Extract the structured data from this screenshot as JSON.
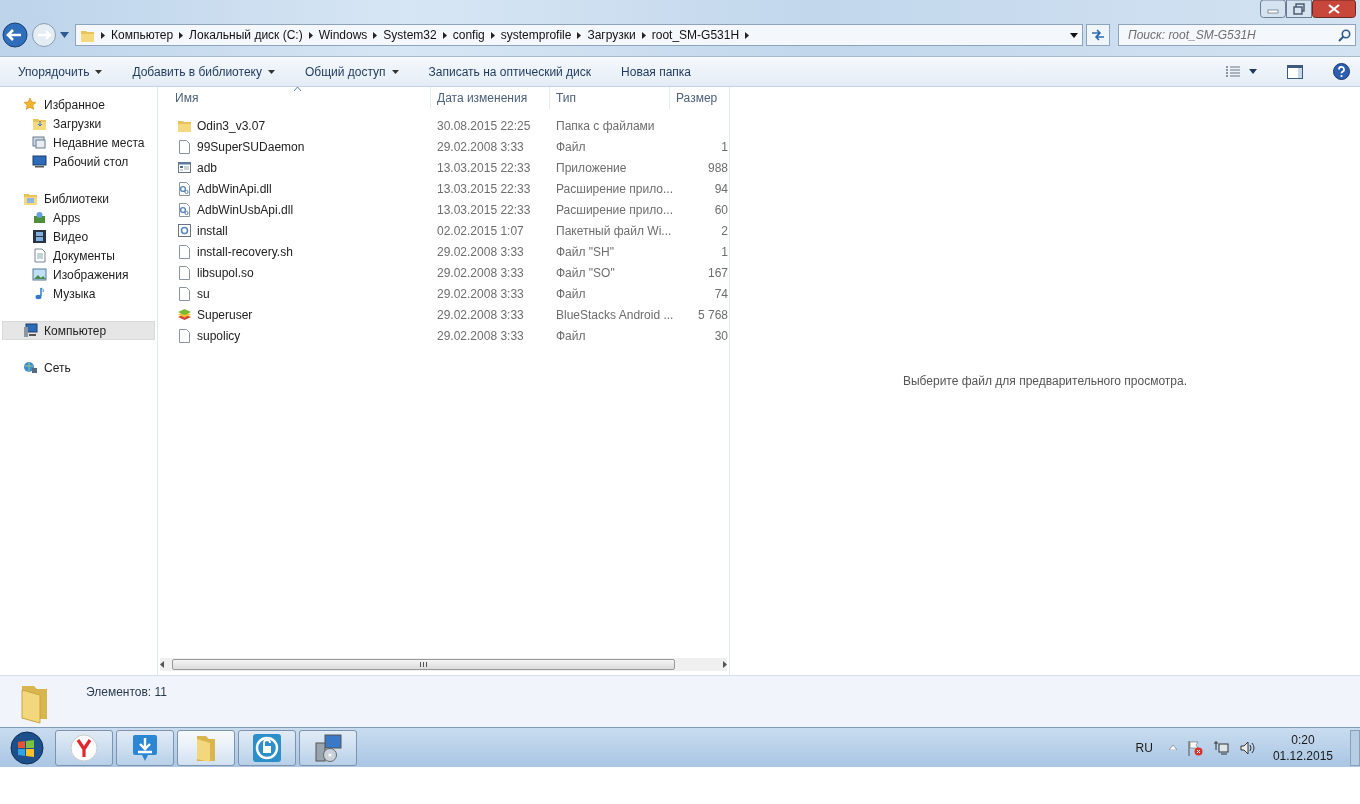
{
  "address_bar": {
    "breadcrumbs": [
      "Компьютер",
      "Локальный диск (C:)",
      "Windows",
      "System32",
      "config",
      "systemprofile",
      "Загрузки",
      "root_SM-G531H"
    ]
  },
  "search": {
    "placeholder": "Поиск: root_SM-G531H"
  },
  "toolbar": {
    "buttons": [
      {
        "label": "Упорядочить",
        "dropdown": true
      },
      {
        "label": "Добавить в библиотеку",
        "dropdown": true
      },
      {
        "label": "Общий доступ",
        "dropdown": true
      },
      {
        "label": "Записать на оптический диск",
        "dropdown": false
      },
      {
        "label": "Новая папка",
        "dropdown": false
      }
    ]
  },
  "sidebar": {
    "groups": [
      {
        "label": "Избранное",
        "kind": "star",
        "selected": false,
        "children": [
          {
            "label": "Загрузки",
            "kind": "downloads",
            "selected": false
          },
          {
            "label": "Недавние места",
            "kind": "recent",
            "selected": false
          },
          {
            "label": "Рабочий стол",
            "kind": "desktop",
            "selected": false
          }
        ]
      },
      {
        "label": "Библиотеки",
        "kind": "library",
        "selected": false,
        "children": [
          {
            "label": "Apps",
            "kind": "apps",
            "selected": false
          },
          {
            "label": "Видео",
            "kind": "video",
            "selected": false
          },
          {
            "label": "Документы",
            "kind": "documents",
            "selected": false
          },
          {
            "label": "Изображения",
            "kind": "pictures",
            "selected": false
          },
          {
            "label": "Музыка",
            "kind": "music",
            "selected": false
          }
        ]
      },
      {
        "label": "Компьютер",
        "kind": "computer",
        "selected": true
      },
      {
        "label": "Сеть",
        "kind": "network",
        "selected": false
      }
    ]
  },
  "table": {
    "columns": [
      {
        "label": "Имя",
        "sorted": true
      },
      {
        "label": "Дата изменения",
        "sorted": false
      },
      {
        "label": "Тип",
        "sorted": false
      },
      {
        "label": "Размер",
        "sorted": false
      }
    ],
    "rows": [
      {
        "kind": "folder",
        "name": "Odin3_v3.07",
        "date": "30.08.2015 22:25",
        "type": "Папка с файлами",
        "size": "",
        "selected": false
      },
      {
        "kind": "file",
        "name": "99SuperSUDaemon",
        "date": "29.02.2008 3:33",
        "type": "Файл",
        "size": "1",
        "selected": false
      },
      {
        "kind": "app",
        "name": "adb",
        "date": "13.03.2015 22:33",
        "type": "Приложение",
        "size": "988",
        "selected": false
      },
      {
        "kind": "dll",
        "name": "AdbWinApi.dll",
        "date": "13.03.2015 22:33",
        "type": "Расширение прило...",
        "size": "94",
        "selected": false
      },
      {
        "kind": "dll",
        "name": "AdbWinUsbApi.dll",
        "date": "13.03.2015 22:33",
        "type": "Расширение прило...",
        "size": "60",
        "selected": false
      },
      {
        "kind": "batch",
        "name": "install",
        "date": "02.02.2015 1:07",
        "type": "Пакетный файл Wi...",
        "size": "2",
        "selected": false
      },
      {
        "kind": "file",
        "name": "install-recovery.sh",
        "date": "29.02.2008 3:33",
        "type": "Файл \"SH\"",
        "size": "1",
        "selected": false
      },
      {
        "kind": "file",
        "name": "libsupol.so",
        "date": "29.02.2008 3:33",
        "type": "Файл \"SO\"",
        "size": "167",
        "selected": false
      },
      {
        "kind": "file",
        "name": "su",
        "date": "29.02.2008 3:33",
        "type": "Файл",
        "size": "74",
        "selected": false
      },
      {
        "kind": "stack",
        "name": "Superuser",
        "date": "29.02.2008 3:33",
        "type": "BlueStacks Android ...",
        "size": "5 768",
        "selected": false
      },
      {
        "kind": "file",
        "name": "supolicy",
        "date": "29.02.2008 3:33",
        "type": "Файл",
        "size": "30",
        "selected": false
      }
    ]
  },
  "preview": {
    "message": "Выберите файл для предварительного просмотра."
  },
  "details": {
    "text": "Элементов: 11"
  },
  "taskbar": {
    "buttons": [
      {
        "kind": "browser",
        "selected": false
      },
      {
        "kind": "download",
        "selected": false
      },
      {
        "kind": "folder",
        "selected": true
      },
      {
        "kind": "sync",
        "selected": false
      },
      {
        "kind": "installer",
        "selected": false
      }
    ],
    "language": "RU",
    "time": "0:20",
    "date": "01.12.2015"
  }
}
